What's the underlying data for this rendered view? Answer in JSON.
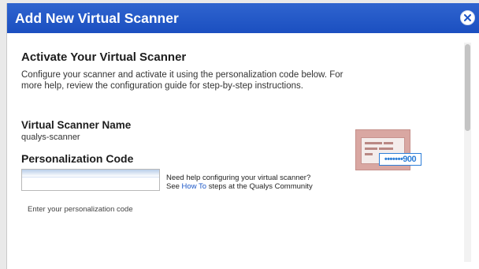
{
  "window": {
    "title": "Add New Virtual Scanner",
    "close_label": "Close"
  },
  "content": {
    "heading": "Activate Your Virtual Scanner",
    "description": "Configure your scanner and activate it using the personalization code below. For more help, review the configuration guide for step-by-step instructions.",
    "scanner_name_label": "Virtual Scanner Name",
    "scanner_name_value": "qualys-scanner",
    "personalization_label": "Personalization Code",
    "personalization_input": {
      "value": "",
      "placeholder": ""
    },
    "help_line1": "Need help configuring your virtual scanner?",
    "help_see": "See ",
    "help_link": "How To",
    "help_rest": " steps at the Qualys Community",
    "hint": "Enter your personalization code"
  },
  "illustration": {
    "code_text": "•••••••900",
    "accent": "#2e7fd8",
    "panel_color": "#d9a7a2"
  },
  "colors": {
    "titlebar": "#1f55c6",
    "link": "#1a56c7"
  }
}
